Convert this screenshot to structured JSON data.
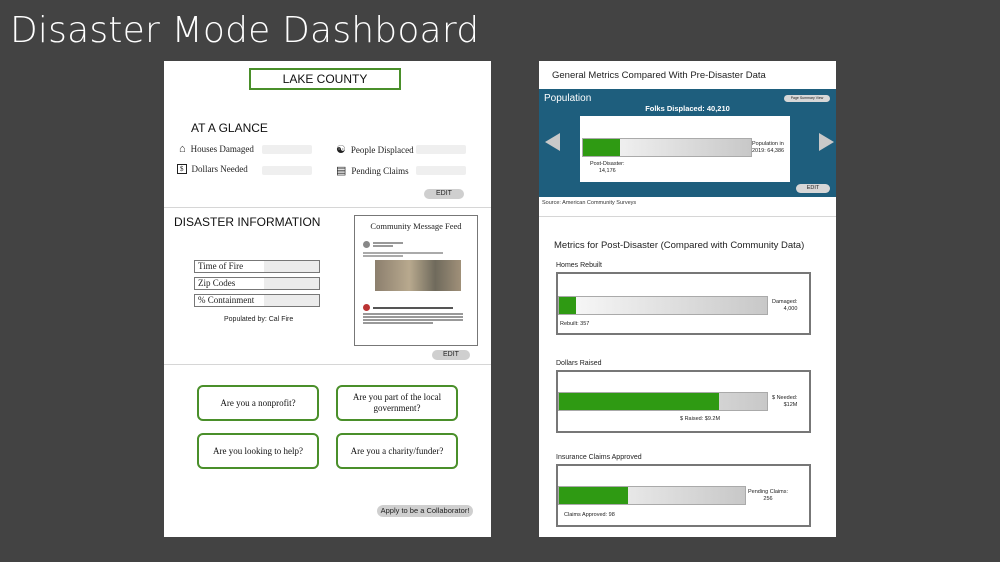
{
  "slide": {
    "title": "Disaster Mode Dashboard"
  },
  "colors": {
    "accent_green": "#4a8f2a",
    "bar_green": "#2f9a13",
    "population_blue": "#1e5e7d",
    "background": "#434343"
  },
  "left": {
    "county": "LAKE COUNTY",
    "glance_title": "AT A GLANCE",
    "glance_items": [
      {
        "label": "Houses Damaged",
        "icon": "house-icon"
      },
      {
        "label": "People Displaced",
        "icon": "people-icon"
      },
      {
        "label": "Dollars Needed",
        "icon": "dollar-bill-icon"
      },
      {
        "label": "Pending Claims",
        "icon": "clipboard-icon"
      }
    ],
    "edit_label": "EDIT",
    "disaster_title": "DISASTER INFORMATION",
    "info_fields": [
      "Time of Fire",
      "Zip Codes",
      "% Containment"
    ],
    "populated_by": "Populated by: Cal Fire",
    "feed_title": "Community Message Feed",
    "feed_edit_label": "EDIT",
    "questions": [
      "Are you a nonprofit?",
      "Are you part of the local government?",
      "Are you looking to help?",
      "Are you a charity/funder?"
    ],
    "collaborator_button": "Apply to be a Collaborator!"
  },
  "right": {
    "title": "General Metrics Compared With Pre-Disaster Data",
    "population": {
      "label": "Population",
      "page_summary": "Page Summary View",
      "folks_displaced": "Folks Displaced: 40,210",
      "post_disaster": "Post-Disaster:\n14,176",
      "pre_disaster": "Population in\n2019: 64,386",
      "fill_fraction": 0.22,
      "edit_label": "EDIT"
    },
    "source": "Source: American Community Surveys",
    "metrics_title": "Metrics for Post-Disaster (Compared with Community Data)",
    "metrics": [
      {
        "label": "Homes Rebuilt",
        "right_text": "Damaged:\n4,000",
        "bottom_text": "Rebuilt: 357",
        "fill_fraction": 0.08
      },
      {
        "label": "Dollars Raised",
        "right_text": "$ Needed:\n$12M",
        "bottom_text": "$ Raised: $9.2M",
        "fill_fraction": 0.77
      },
      {
        "label": "Insurance Claims Approved",
        "right_text": "Pending Claims:\n256",
        "bottom_text": "Claims Approved: 98",
        "fill_fraction": 0.37
      }
    ]
  }
}
